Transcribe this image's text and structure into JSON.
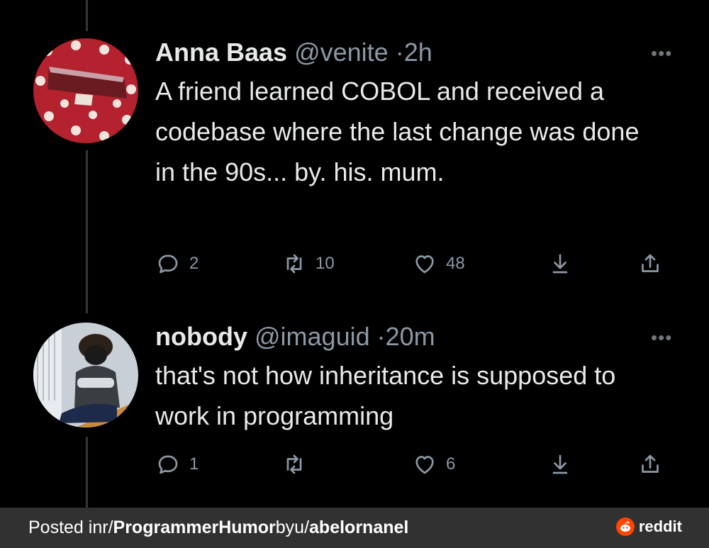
{
  "tweets": [
    {
      "name": "Anna Baas",
      "handle": "@venite",
      "separator": "·",
      "time": "2h",
      "text": "A friend learned COBOL and received a codebase where the last change was done in the 90s... by. his. mum.",
      "replies": "2",
      "retweets": "10",
      "likes": "48",
      "more": "•••"
    },
    {
      "name": "nobody",
      "handle": "@imaguid",
      "separator": "·",
      "time": "20m",
      "text": "that's not how inheritance is supposed to work in programming",
      "replies": "1",
      "retweets": "",
      "likes": "6",
      "more": "•••"
    }
  ],
  "footer": {
    "prefix": "Posted in ",
    "subreddit_prefix": "r/",
    "subreddit": "ProgrammerHumor",
    "by": " by ",
    "user_prefix": "u/",
    "user": "abelornanel",
    "brand": "reddit"
  },
  "colors": {
    "background": "#000000",
    "text": "#e7e9ea",
    "muted": "#8b98a5",
    "footer_bg": "#313131",
    "reddit_orange": "#ff4500"
  },
  "icons": [
    "reply-icon",
    "retweet-icon",
    "like-icon",
    "bookmark-icon",
    "share-icon",
    "more-icon",
    "reddit-logo-icon"
  ]
}
